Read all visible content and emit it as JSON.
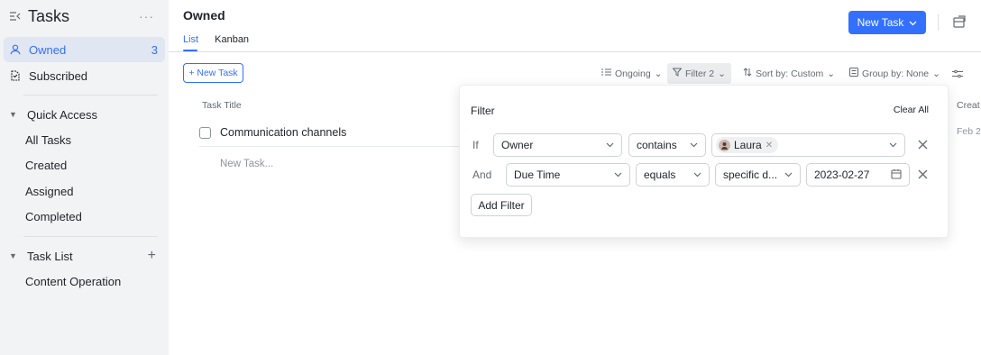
{
  "sidebar": {
    "title": "Tasks",
    "more": "···",
    "items": [
      {
        "label": "Owned",
        "count": "3"
      },
      {
        "label": "Subscribed"
      }
    ],
    "quick_access": {
      "title": "Quick Access",
      "items": [
        "All Tasks",
        "Created",
        "Assigned",
        "Completed"
      ]
    },
    "task_list": {
      "title": "Task List",
      "items": [
        "Content Operation"
      ]
    }
  },
  "header": {
    "title": "Owned",
    "tabs": [
      "List",
      "Kanban"
    ],
    "new_task_button": "New Task"
  },
  "toolbar": {
    "add_task": "+ New Task",
    "status": "Ongoing",
    "filter": "Filter 2",
    "sort": "Sort by: Custom",
    "group": "Group by: None"
  },
  "table": {
    "columns": [
      "Task Title",
      "Creat"
    ],
    "rows": [
      {
        "title": "Communication channels",
        "created": "Feb 2"
      }
    ],
    "new_task_placeholder": "New Task..."
  },
  "filter_panel": {
    "title": "Filter",
    "clear_all": "Clear All",
    "conditions": [
      {
        "conjunction": "If",
        "field": "Owner",
        "operator": "contains",
        "value_chip": "Laura"
      },
      {
        "conjunction": "And",
        "field": "Due Time",
        "operator": "equals",
        "mode": "specific d...",
        "date": "2023-02-27"
      }
    ],
    "add_filter": "Add Filter"
  },
  "colors": {
    "accent": "#3370ff",
    "sidebar_bg": "#f2f3f5",
    "active_item_bg": "#e1e6f3"
  }
}
